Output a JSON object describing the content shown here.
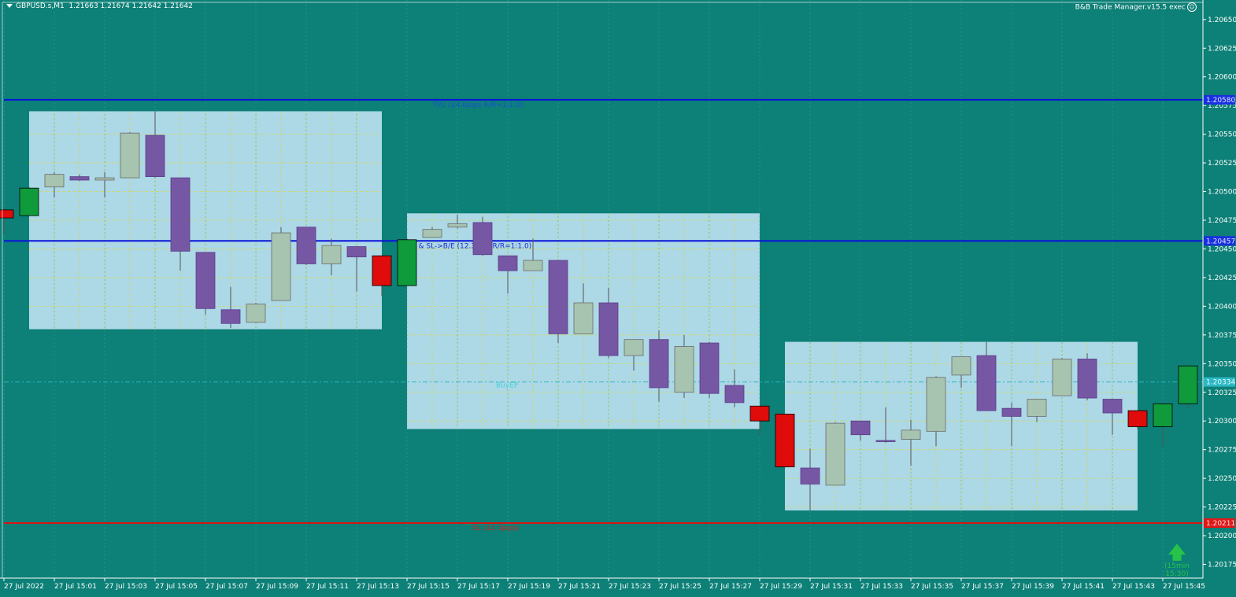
{
  "header": {
    "symbol": "GBPUSD.s,M1",
    "ohlc": "1.21663 1.21674 1.21642 1.21642",
    "ea_name": "B&B Trade Manager.v15.5 exec"
  },
  "colors": {
    "background": "#0d8077",
    "bull_candle": "#a7c4b0",
    "bear_candle": "#7657a3",
    "bull_current": "#0f9a3c",
    "bear_current": "#e00b0b",
    "zone_fill": "#add8e6",
    "grid": "#cfd95c",
    "tp_line": "#0a14d9",
    "sl_line": "#d91414",
    "entry_line": "#2fb6c4"
  },
  "levels": {
    "tp2": {
      "price": 1.2058,
      "label": "TP2 (24.6pips R/R=1:2.0)",
      "tag": "1.20580"
    },
    "tp1": {
      "price": 1.20457,
      "label": "TP1 & SL->B/E (12.3pips R/R=1:1.0)",
      "tag": "1.20457"
    },
    "entry": {
      "price": 1.20334,
      "label": "BuyEP",
      "tag": "1.20334"
    },
    "sl": {
      "price": 1.20211,
      "label": "SL (12.3pips)",
      "tag": "1.20211"
    }
  },
  "signal": {
    "arrow": "up-arrow-icon",
    "text": "(15min 15:30)"
  },
  "chart_data": {
    "type": "candlestick",
    "title": "GBPUSD.s,M1",
    "ylim": [
      1.20163,
      1.20667
    ],
    "y_ticks": [
      "1.20650",
      "1.20625",
      "1.20600",
      "1.20575",
      "1.20550",
      "1.20525",
      "1.20500",
      "1.20475",
      "1.20450",
      "1.20425",
      "1.20400",
      "1.20375",
      "1.20350",
      "1.20325",
      "1.20300",
      "1.20275",
      "1.20250",
      "1.20225",
      "1.20200",
      "1.20175"
    ],
    "x_ticks": [
      "27 Jul 2022",
      "27 Jul 15:01",
      "27 Jul 15:03",
      "27 Jul 15:05",
      "27 Jul 15:07",
      "27 Jul 15:09",
      "27 Jul 15:11",
      "27 Jul 15:13",
      "27 Jul 15:15",
      "27 Jul 15:17",
      "27 Jul 15:19",
      "27 Jul 15:21",
      "27 Jul 15:23",
      "27 Jul 15:25",
      "27 Jul 15:27",
      "27 Jul 15:29",
      "27 Jul 15:31",
      "27 Jul 15:33",
      "27 Jul 15:35",
      "27 Jul 15:37",
      "27 Jul 15:39",
      "27 Jul 15:41",
      "27 Jul 15:43",
      "27 Jul 15:45"
    ],
    "zones": [
      {
        "from": 1,
        "to": 15,
        "high": 1.2057,
        "low": 1.2038
      },
      {
        "from": 16,
        "to": 30,
        "high": 1.20481,
        "low": 1.20293
      },
      {
        "from": 31,
        "to": 45,
        "high": 1.20369,
        "low": 1.20222
      }
    ],
    "candles": [
      {
        "o": 1.20484,
        "h": 1.20486,
        "l": 1.20463,
        "c": 1.20477,
        "style": "bear_current"
      },
      {
        "o": 1.20479,
        "h": 1.20504,
        "l": 1.20479,
        "c": 1.20503,
        "style": "bull_current"
      },
      {
        "o": 1.20504,
        "h": 1.20517,
        "l": 1.20495,
        "c": 1.20515,
        "style": "bull"
      },
      {
        "o": 1.20513,
        "h": 1.20515,
        "l": 1.20509,
        "c": 1.2051,
        "style": "bear"
      },
      {
        "o": 1.2051,
        "h": 1.20517,
        "l": 1.20495,
        "c": 1.20512,
        "style": "bull"
      },
      {
        "o": 1.20512,
        "h": 1.20552,
        "l": 1.20512,
        "c": 1.20551,
        "style": "bull"
      },
      {
        "o": 1.20549,
        "h": 1.2057,
        "l": 1.20512,
        "c": 1.20513,
        "style": "bear"
      },
      {
        "o": 1.20512,
        "h": 1.20512,
        "l": 1.20431,
        "c": 1.20448,
        "style": "bear"
      },
      {
        "o": 1.20447,
        "h": 1.20447,
        "l": 1.20393,
        "c": 1.20398,
        "style": "bear"
      },
      {
        "o": 1.20397,
        "h": 1.20417,
        "l": 1.20381,
        "c": 1.20385,
        "style": "bear"
      },
      {
        "o": 1.20386,
        "h": 1.20403,
        "l": 1.20386,
        "c": 1.20402,
        "style": "bull"
      },
      {
        "o": 1.20405,
        "h": 1.20469,
        "l": 1.20405,
        "c": 1.20464,
        "style": "bull"
      },
      {
        "o": 1.20469,
        "h": 1.20469,
        "l": 1.20436,
        "c": 1.20437,
        "style": "bear"
      },
      {
        "o": 1.20437,
        "h": 1.20459,
        "l": 1.20427,
        "c": 1.20453,
        "style": "bull"
      },
      {
        "o": 1.20452,
        "h": 1.20452,
        "l": 1.20413,
        "c": 1.20443,
        "style": "bear"
      },
      {
        "o": 1.20444,
        "h": 1.20444,
        "l": 1.20409,
        "c": 1.20418,
        "style": "bear_current"
      },
      {
        "o": 1.20418,
        "h": 1.20459,
        "l": 1.20418,
        "c": 1.20458,
        "style": "bull_current"
      },
      {
        "o": 1.2046,
        "h": 1.20469,
        "l": 1.2046,
        "c": 1.20467,
        "style": "bull"
      },
      {
        "o": 1.20469,
        "h": 1.2048,
        "l": 1.20468,
        "c": 1.20472,
        "style": "bull"
      },
      {
        "o": 1.20473,
        "h": 1.20478,
        "l": 1.20444,
        "c": 1.20445,
        "style": "bear"
      },
      {
        "o": 1.20444,
        "h": 1.20444,
        "l": 1.20411,
        "c": 1.20431,
        "style": "bear"
      },
      {
        "o": 1.20431,
        "h": 1.20459,
        "l": 1.20431,
        "c": 1.2044,
        "style": "bull"
      },
      {
        "o": 1.2044,
        "h": 1.2044,
        "l": 1.20368,
        "c": 1.20376,
        "style": "bear"
      },
      {
        "o": 1.20376,
        "h": 1.2042,
        "l": 1.20376,
        "c": 1.20403,
        "style": "bull"
      },
      {
        "o": 1.20403,
        "h": 1.20416,
        "l": 1.20355,
        "c": 1.20357,
        "style": "bear"
      },
      {
        "o": 1.20357,
        "h": 1.20371,
        "l": 1.20344,
        "c": 1.20371,
        "style": "bull"
      },
      {
        "o": 1.20371,
        "h": 1.20379,
        "l": 1.20317,
        "c": 1.20329,
        "style": "bear"
      },
      {
        "o": 1.20325,
        "h": 1.20375,
        "l": 1.2032,
        "c": 1.20365,
        "style": "bull"
      },
      {
        "o": 1.20368,
        "h": 1.20369,
        "l": 1.2032,
        "c": 1.20324,
        "style": "bear"
      },
      {
        "o": 1.20331,
        "h": 1.20345,
        "l": 1.20312,
        "c": 1.20316,
        "style": "bear"
      },
      {
        "o": 1.20313,
        "h": 1.20313,
        "l": 1.20287,
        "c": 1.203,
        "style": "bear_current"
      },
      {
        "o": 1.20306,
        "h": 1.20306,
        "l": 1.20259,
        "c": 1.2026,
        "style": "bear_current"
      },
      {
        "o": 1.20259,
        "h": 1.20276,
        "l": 1.20222,
        "c": 1.20245,
        "style": "bear"
      },
      {
        "o": 1.20244,
        "h": 1.20299,
        "l": 1.20244,
        "c": 1.20298,
        "style": "bull"
      },
      {
        "o": 1.203,
        "h": 1.203,
        "l": 1.20283,
        "c": 1.20288,
        "style": "bear"
      },
      {
        "o": 1.20283,
        "h": 1.20312,
        "l": 1.20281,
        "c": 1.20282,
        "style": "bear"
      },
      {
        "o": 1.20284,
        "h": 1.20301,
        "l": 1.20261,
        "c": 1.20292,
        "style": "bull"
      },
      {
        "o": 1.20291,
        "h": 1.20339,
        "l": 1.20278,
        "c": 1.20338,
        "style": "bull"
      },
      {
        "o": 1.2034,
        "h": 1.20356,
        "l": 1.20329,
        "c": 1.20356,
        "style": "bull"
      },
      {
        "o": 1.20357,
        "h": 1.20369,
        "l": 1.20309,
        "c": 1.20309,
        "style": "bear"
      },
      {
        "o": 1.20311,
        "h": 1.20316,
        "l": 1.20278,
        "c": 1.20304,
        "style": "bear"
      },
      {
        "o": 1.20304,
        "h": 1.20319,
        "l": 1.20299,
        "c": 1.20319,
        "style": "bull"
      },
      {
        "o": 1.20322,
        "h": 1.20355,
        "l": 1.20322,
        "c": 1.20354,
        "style": "bull"
      },
      {
        "o": 1.20354,
        "h": 1.20359,
        "l": 1.20318,
        "c": 1.2032,
        "style": "bear"
      },
      {
        "o": 1.20319,
        "h": 1.20319,
        "l": 1.20288,
        "c": 1.20307,
        "style": "bear"
      },
      {
        "o": 1.20309,
        "h": 1.20309,
        "l": 1.20293,
        "c": 1.20295,
        "style": "bear_current"
      },
      {
        "o": 1.20295,
        "h": 1.20316,
        "l": 1.20278,
        "c": 1.20315,
        "style": "bull_current"
      },
      {
        "o": 1.20315,
        "h": 1.20349,
        "l": 1.20311,
        "c": 1.20348,
        "style": "bull_current"
      }
    ]
  }
}
